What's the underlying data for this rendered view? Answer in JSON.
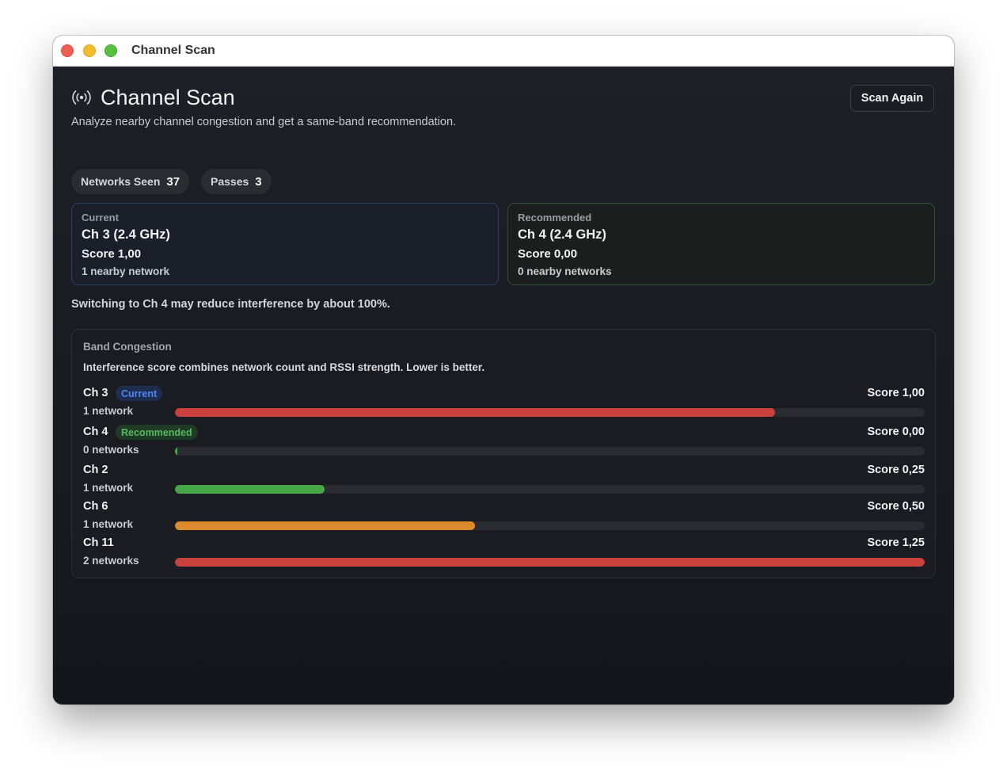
{
  "window": {
    "title": "Channel Scan"
  },
  "header": {
    "icon": "broadcast-icon",
    "title": "Channel Scan",
    "subtitle": "Analyze nearby channel congestion and get a same-band recommendation.",
    "scan_button": "Scan Again"
  },
  "stats": {
    "networks_label": "Networks Seen",
    "networks_value": "37",
    "passes_label": "Passes",
    "passes_value": "3"
  },
  "current": {
    "label": "Current",
    "channel": "Ch 3 (2.4 GHz)",
    "score": "Score 1,00",
    "nearby": "1 nearby network"
  },
  "recommended": {
    "label": "Recommended",
    "channel": "Ch 4 (2.4 GHz)",
    "score": "Score 0,00",
    "nearby": "0 nearby networks"
  },
  "switch_message": "Switching to Ch 4 may reduce interference by about 100%.",
  "band": {
    "title": "Band Congestion",
    "description": "Interference score combines network count and RSSI strength. Lower is better.",
    "max_score": 1.25,
    "rows": [
      {
        "channel": "Ch 3",
        "badge": "Current",
        "networks": "1 network",
        "score_label": "Score 1,00",
        "score": 1.0,
        "color": "#c9413c"
      },
      {
        "channel": "Ch 4",
        "badge": "Recommended",
        "networks": "0 networks",
        "score_label": "Score 0,00",
        "score": 0.0,
        "color": "#46a648"
      },
      {
        "channel": "Ch 2",
        "badge": "",
        "networks": "1 network",
        "score_label": "Score 0,25",
        "score": 0.25,
        "color": "#46a648"
      },
      {
        "channel": "Ch 6",
        "badge": "",
        "networks": "1 network",
        "score_label": "Score 0,50",
        "score": 0.5,
        "color": "#dc8a2e"
      },
      {
        "channel": "Ch 11",
        "badge": "",
        "networks": "2 networks",
        "score_label": "Score 1,25",
        "score": 1.25,
        "color": "#c9413c"
      }
    ]
  }
}
